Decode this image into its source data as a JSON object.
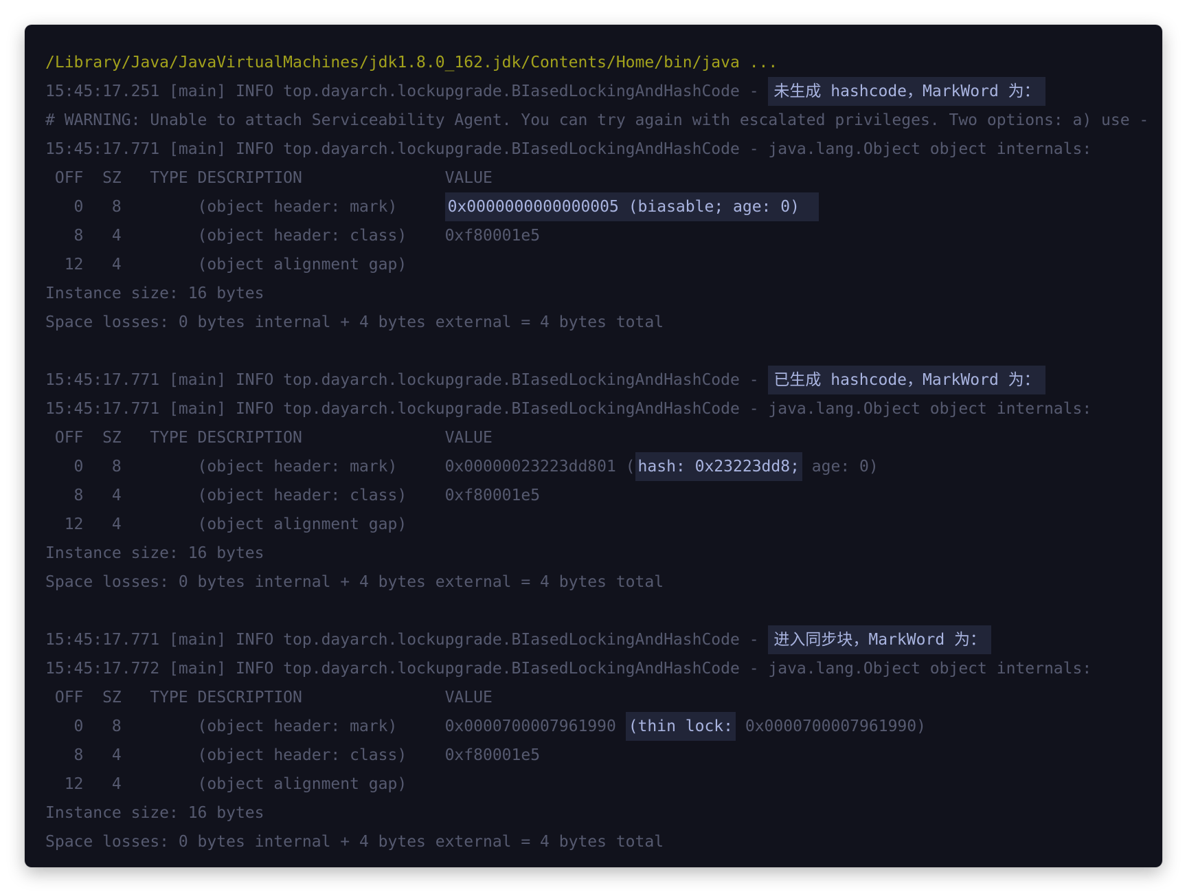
{
  "console": {
    "lines": {
      "l0": "/Library/Java/JavaVirtualMachines/jdk1.8.0_162.jdk/Contents/Home/bin/java ...",
      "l1_prefix": "15:45:17.251 [main] INFO top.dayarch.lockupgrade.BIasedLockingAndHashCode - ",
      "l1_hl": "未生成 hashcode，MarkWord 为：",
      "l2": "# WARNING: Unable to attach Serviceability Agent. You can try again with escalated privileges. Two options: a) use -",
      "l3": "15:45:17.771 [main] INFO top.dayarch.lockupgrade.BIasedLockingAndHashCode - java.lang.Object object internals:",
      "hdr1": " OFF  SZ   TYPE DESCRIPTION               VALUE",
      "r1a_left": "   0   8        (object header: mark)     ",
      "r1a_hl": "0x0000000000000005 (biasable; age: 0)",
      "r1b": "   8   4        (object header: class)    0xf80001e5",
      "r1c": "  12   4        (object alignment gap)    ",
      "inst1": "Instance size: 16 bytes",
      "loss1": "Space losses: 0 bytes internal + 4 bytes external = 4 bytes total",
      "l4_prefix": "15:45:17.771 [main] INFO top.dayarch.lockupgrade.BIasedLockingAndHashCode - ",
      "l4_hl": "已生成 hashcode，MarkWord 为：",
      "l5": "15:45:17.771 [main] INFO top.dayarch.lockupgrade.BIasedLockingAndHashCode - java.lang.Object object internals:",
      "hdr2": " OFF  SZ   TYPE DESCRIPTION               VALUE",
      "r2a_left": "   0   8        (object header: mark)     0x00000023223dd801 (",
      "r2a_hl": "hash: 0x23223dd8;",
      "r2a_right": " age: 0)",
      "r2b": "   8   4        (object header: class)    0xf80001e5",
      "r2c": "  12   4        (object alignment gap)    ",
      "inst2": "Instance size: 16 bytes",
      "loss2": "Space losses: 0 bytes internal + 4 bytes external = 4 bytes total",
      "l6_prefix": "15:45:17.771 [main] INFO top.dayarch.lockupgrade.BIasedLockingAndHashCode - ",
      "l6_hl": "进入同步块，MarkWord 为：",
      "l7": "15:45:17.772 [main] INFO top.dayarch.lockupgrade.BIasedLockingAndHashCode - java.lang.Object object internals:",
      "hdr3": " OFF  SZ   TYPE DESCRIPTION               VALUE",
      "r3a_left": "   0   8        (object header: mark)     0x0000700007961990 ",
      "r3a_hl": "(thin lock:",
      "r3a_right": " 0x0000700007961990)",
      "r3b": "   8   4        (object header: class)    0xf80001e5",
      "r3c": "  12   4        (object alignment gap)    ",
      "inst3": "Instance size: 16 bytes",
      "loss3": "Space losses: 0 bytes internal + 4 bytes external = 4 bytes total"
    }
  }
}
